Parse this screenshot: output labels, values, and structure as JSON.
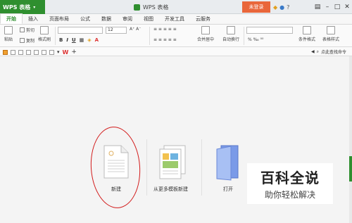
{
  "app": {
    "name": "WPS 表格",
    "caret": "▾"
  },
  "window": {
    "title": "WPS 表格",
    "login_label": "未登录",
    "min": "–",
    "max": "□",
    "close": "✕",
    "more": "▤",
    "help": "?"
  },
  "tabs": [
    "开始",
    "插入",
    "页面布局",
    "公式",
    "数据",
    "审阅",
    "视图",
    "开发工具",
    "云服务"
  ],
  "ribbon": {
    "cut": "剪切",
    "paste": "粘贴",
    "copy": "复制",
    "format_painter": "格式刷",
    "font_size": "12",
    "bold": "B",
    "italic": "I",
    "underline": "U",
    "merge": "合并居中",
    "wrap": "自动换行",
    "conditional_format": "条件格式",
    "table_style": "表格样式"
  },
  "quick": {
    "search": "点此查找命令"
  },
  "cards": [
    {
      "label": "新建"
    },
    {
      "label": "从更多模板新建"
    },
    {
      "label": "打开"
    }
  ],
  "watermark": {
    "title": "百科全说",
    "subtitle": "助你轻松解决"
  },
  "colors": {
    "brand": "#2f8f2f",
    "login": "#e9663a",
    "annotation": "#d21a1a"
  }
}
